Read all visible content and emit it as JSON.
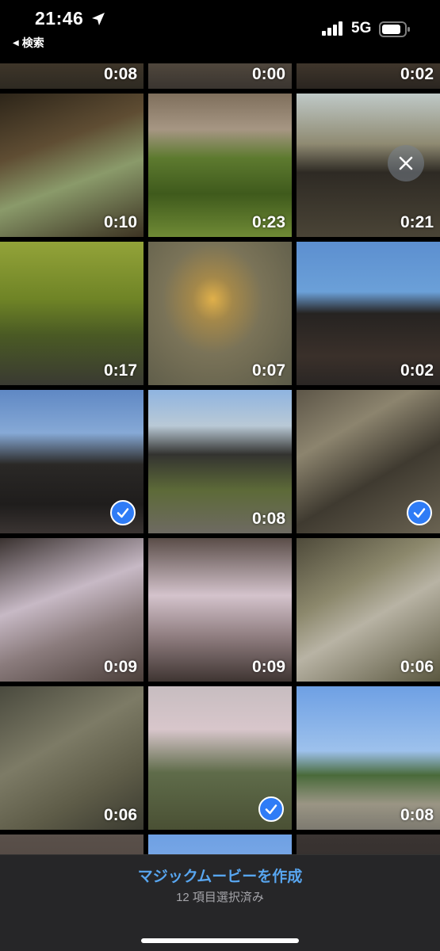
{
  "status_bar": {
    "time": "21:46",
    "back_label": "検索",
    "network": "5G"
  },
  "grid": {
    "tiles": [
      {
        "duration": "0:08",
        "selected": false
      },
      {
        "duration": "0:00",
        "selected": false
      },
      {
        "duration": "0:02",
        "selected": false
      },
      {
        "duration": "0:10",
        "selected": false
      },
      {
        "duration": "0:23",
        "selected": false
      },
      {
        "duration": "0:21",
        "selected": false
      },
      {
        "duration": "0:17",
        "selected": false
      },
      {
        "duration": "0:07",
        "selected": false
      },
      {
        "duration": "0:02",
        "selected": false
      },
      {
        "duration": "",
        "selected": true
      },
      {
        "duration": "0:08",
        "selected": false
      },
      {
        "duration": "",
        "selected": true
      },
      {
        "duration": "0:09",
        "selected": false
      },
      {
        "duration": "0:09",
        "selected": false
      },
      {
        "duration": "0:06",
        "selected": false
      },
      {
        "duration": "0:06",
        "selected": false
      },
      {
        "duration": "",
        "selected": true
      },
      {
        "duration": "0:08",
        "selected": false
      }
    ]
  },
  "bottom_bar": {
    "action_label": "マジックムービーを作成",
    "selection_count": "12 項目選択済み"
  },
  "colors": {
    "accent": "#58a6f0",
    "check": "#2f7cf6"
  }
}
